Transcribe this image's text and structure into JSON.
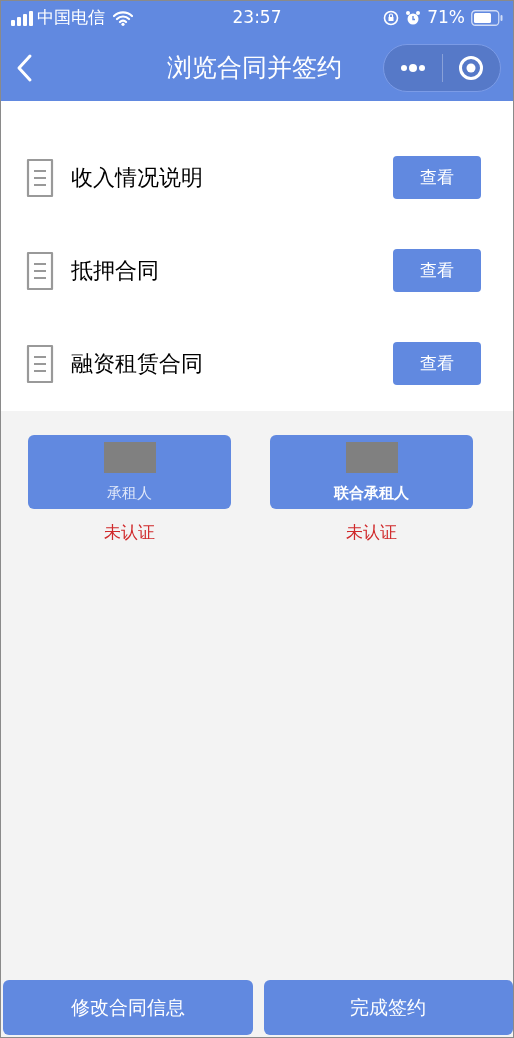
{
  "status_bar": {
    "carrier": "中国电信",
    "time": "23:57",
    "battery": "71%"
  },
  "nav": {
    "title": "浏览合同并签约"
  },
  "documents": [
    {
      "name": "收入情况说明",
      "action": "查看"
    },
    {
      "name": "抵押合同",
      "action": "查看"
    },
    {
      "name": "融资租赁合同",
      "action": "查看"
    }
  ],
  "parties": [
    {
      "label": "承租人",
      "status": "未认证"
    },
    {
      "label": "联合承租人",
      "status": "未认证"
    }
  ],
  "footer_buttons": [
    "修改合同信息",
    "完成签约"
  ]
}
